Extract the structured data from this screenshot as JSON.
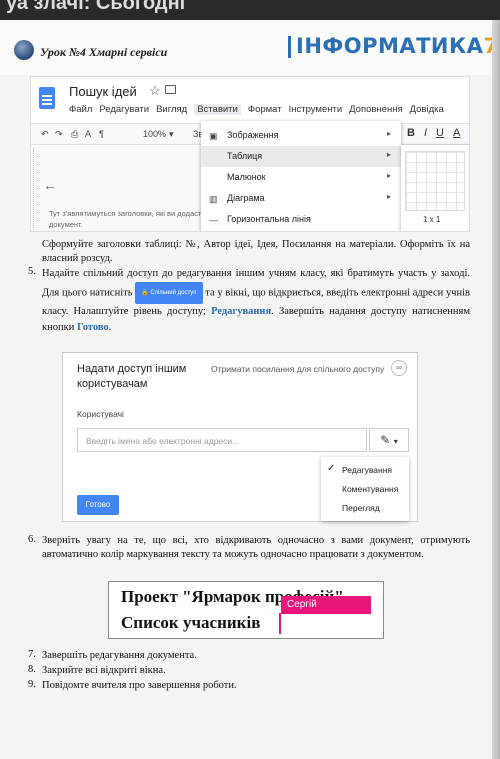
{
  "top_strip": {
    "text": "уа злачі: Сьогодні"
  },
  "header": {
    "title": "Урок №4 Хмарні сервіси",
    "brand_main": "ІНФОРМАТИКА",
    "brand_num": "7"
  },
  "gdocs": {
    "doc_title": "Пошук ідей",
    "menu": [
      "Файл",
      "Редагувати",
      "Вигляд",
      "Вставити",
      "Формат",
      "Інструменти",
      "Доповнення",
      "Довідка"
    ],
    "toolbar": {
      "zoom": "100%",
      "zoom_extra": "Зв"
    },
    "hint": "Тут з'являтимуться заголовки, які ви додасте в документ.",
    "insert_menu": [
      {
        "label": "Зображення",
        "icon": "image-icon",
        "arrow": true
      },
      {
        "label": "Таблиця",
        "icon": "",
        "arrow": true
      },
      {
        "label": "Малюнок",
        "icon": "",
        "arrow": true
      },
      {
        "label": "Діаграма",
        "icon": "chart-icon",
        "arrow": true
      },
      {
        "label": "Горизонтальна лінія",
        "icon": "line-icon",
        "arrow": false
      }
    ],
    "table_size": "1 x 1",
    "format_buttons": [
      "B",
      "I",
      "U",
      "A"
    ]
  },
  "text": {
    "p_intro": "Сформуйте заголовки таблиці: №, Автор ідеї, Ідея, Посилання на матеріали. Оформіть їх на власний розсуд.",
    "n5": "5.",
    "p5_a": "Надайте спільний доступ до редагування іншим учням класу, які братимуть участь у заході. Для цього натисніть",
    "share_btn": "Спільний доступ",
    "p5_b": "та у вікні, що відкриється, введіть електронні адреси учнів класу. Налаштуйте рівень доступу;",
    "p5_edit": "Редагування",
    "p5_c": ". Завершіть надання доступу натисненням кнопки",
    "p5_done": "Готово",
    "p5_end": ".",
    "n6": "6.",
    "p6": "Зверніть увагу на те, що всі, хто відкривають одночасно з вами документ, отримують автоматично колір маркування тексту та можуть одночасно працювати з документом.",
    "n7": "7.",
    "p7": "Завершіть редагування документа.",
    "n8": "8.",
    "p8": "Закрийте всі відкриті вікна.",
    "n9": "9.",
    "p9": "Повідомте вчителя про завершення роботи."
  },
  "share_dialog": {
    "title": "Надати доступ іншим користувачам",
    "get_link": "Отримати посилання для спільного доступу",
    "users_label": "Користувачі",
    "input_placeholder": "Введіть імена або електронні адреси...",
    "done_button": "Готово",
    "permissions": [
      "Редагування",
      "Коментування",
      "Перегляд"
    ],
    "selected_permission": "Редагування"
  },
  "project": {
    "line1": "Проект \"Ярмарок професій\"",
    "line2": "Список учасників",
    "collaborator": "Сергій",
    "collaborator_color": "#e8157a"
  }
}
